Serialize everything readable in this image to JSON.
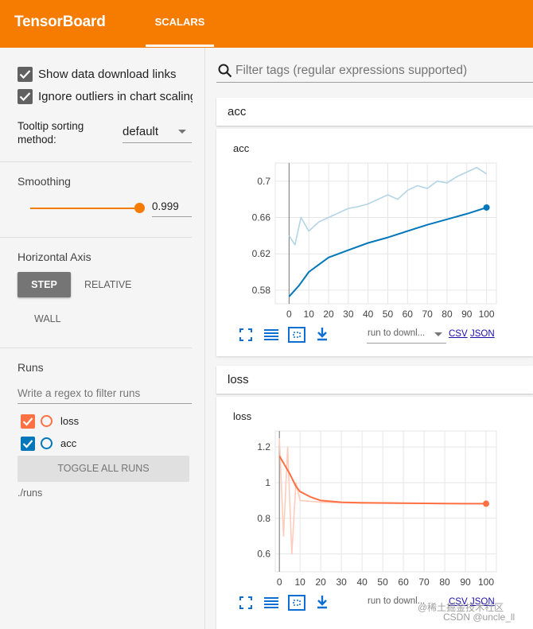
{
  "header": {
    "brand": "TensorBoard",
    "tabs": [
      {
        "label": "SCALARS",
        "active": true
      }
    ],
    "accent": "#f57c00"
  },
  "sidebar": {
    "checkboxes": [
      {
        "label": "Show data download links",
        "checked": true
      },
      {
        "label": "Ignore outliers in chart scaling",
        "checked": true
      }
    ],
    "tooltip_sorting": {
      "label_line1": "Tooltip sorting",
      "label_line2": "method:",
      "value": "default"
    },
    "smoothing": {
      "title": "Smoothing",
      "value": "0.999",
      "fraction": 0.999
    },
    "horizontal_axis": {
      "title": "Horizontal Axis",
      "options": [
        "STEP",
        "RELATIVE",
        "WALL"
      ],
      "selected": "STEP"
    },
    "runs": {
      "title": "Runs",
      "filter_placeholder": "Write a regex to filter runs",
      "items": [
        {
          "name": "loss",
          "checked": true,
          "color": "#ff7043"
        },
        {
          "name": "acc",
          "checked": true,
          "color": "#0077bb"
        }
      ],
      "toggle_label": "TOGGLE ALL RUNS",
      "logdir": "./runs"
    }
  },
  "main": {
    "filter_placeholder": "Filter tags (regular expressions supported)",
    "groups": [
      {
        "name": "acc",
        "card_title": "acc",
        "run_select": "run to downl...",
        "csv": "CSV",
        "json": "JSON"
      },
      {
        "name": "loss",
        "card_title": "loss",
        "run_select": "run to downl...",
        "csv": "CSV",
        "json": "JSON"
      }
    ]
  },
  "watermark": {
    "line1": "@稀土掘金技术社区",
    "line2": "CSDN @uncle_ll"
  },
  "icons": [
    "search-icon",
    "checkbox-checked-icon",
    "dropdown-arrow-icon",
    "fit-domain-icon",
    "data-series-icon",
    "select-area-icon",
    "download-icon"
  ],
  "chart_data": [
    {
      "type": "line",
      "title": "acc",
      "x_ticks": [
        0,
        10,
        20,
        30,
        40,
        50,
        60,
        70,
        80,
        90,
        100
      ],
      "y_ticks": [
        0.58,
        0.62,
        0.66,
        0.7
      ],
      "xlim": [
        -7,
        105
      ],
      "ylim": [
        0.565,
        0.72
      ],
      "series": [
        {
          "name": "acc",
          "smoothed": true,
          "color": "#0077bb",
          "x": [
            0,
            5,
            10,
            15,
            20,
            30,
            40,
            50,
            60,
            70,
            80,
            90,
            100
          ],
          "y": [
            0.573,
            0.585,
            0.6,
            0.608,
            0.616,
            0.624,
            0.632,
            0.638,
            0.645,
            0.652,
            0.658,
            0.664,
            0.671
          ]
        },
        {
          "name": "acc",
          "smoothed": false,
          "color": "#b3d4e5",
          "x": [
            0,
            3,
            6,
            10,
            15,
            20,
            25,
            30,
            35,
            40,
            45,
            50,
            55,
            60,
            65,
            70,
            75,
            80,
            85,
            90,
            95,
            100
          ],
          "y": [
            0.64,
            0.63,
            0.66,
            0.645,
            0.655,
            0.66,
            0.665,
            0.67,
            0.672,
            0.675,
            0.68,
            0.685,
            0.68,
            0.69,
            0.695,
            0.692,
            0.7,
            0.698,
            0.705,
            0.71,
            0.715,
            0.708
          ]
        }
      ]
    },
    {
      "type": "line",
      "title": "loss",
      "x_ticks": [
        0,
        10,
        20,
        30,
        40,
        50,
        60,
        70,
        80,
        90,
        100
      ],
      "y_ticks": [
        0.6,
        0.8,
        1,
        1.2
      ],
      "xlim": [
        -2,
        105
      ],
      "ylim": [
        0.5,
        1.29
      ],
      "series": [
        {
          "name": "loss",
          "smoothed": true,
          "color": "#ff7043",
          "x": [
            0,
            5,
            8,
            10,
            15,
            20,
            25,
            30,
            40,
            50,
            60,
            70,
            80,
            90,
            100
          ],
          "y": [
            1.15,
            1.05,
            0.98,
            0.95,
            0.92,
            0.9,
            0.895,
            0.89,
            0.887,
            0.886,
            0.885,
            0.884,
            0.883,
            0.882,
            0.882
          ]
        },
        {
          "name": "loss",
          "smoothed": false,
          "color": "#ffccbc",
          "x": [
            0,
            2,
            4,
            6,
            8,
            10,
            20,
            40,
            60,
            80,
            100
          ],
          "y": [
            1.25,
            0.7,
            1.2,
            0.6,
            1.0,
            0.9,
            0.89,
            0.885,
            0.884,
            0.883,
            0.882
          ]
        }
      ]
    }
  ]
}
